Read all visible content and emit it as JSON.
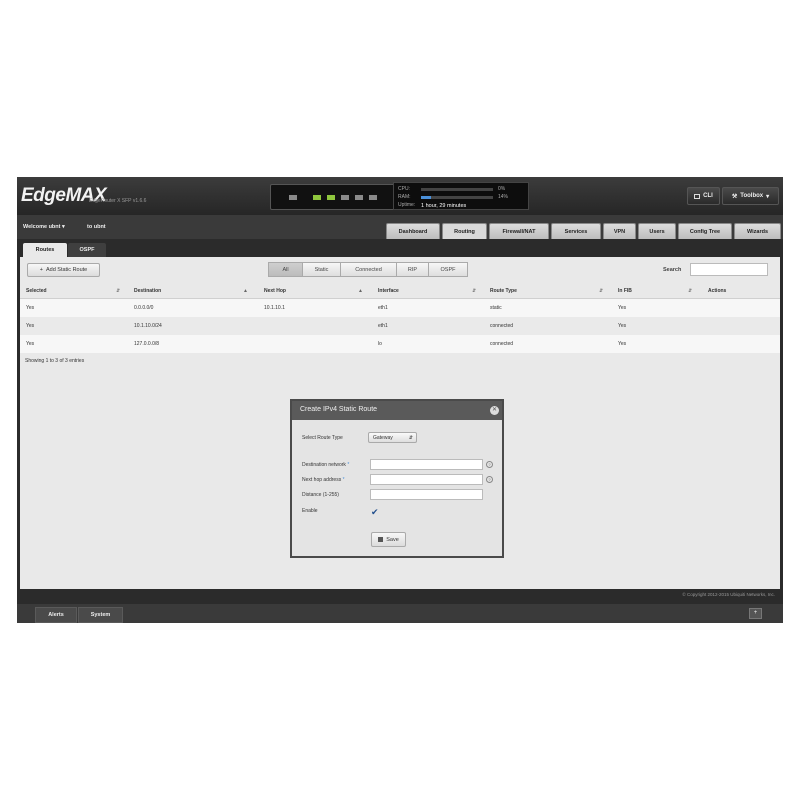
{
  "app": {
    "logo": "EdgeMAX",
    "device": "EdgeRouter X SFP v1.6.6"
  },
  "status": {
    "cpu_label": "CPU:",
    "cpu_value": "0%",
    "cpu_fraction": 0.0,
    "ram_label": "RAM:",
    "ram_value": "14%",
    "ram_fraction": 0.14,
    "uptime_label": "Uptime:",
    "uptime_value": "1 hour, 29 minutes"
  },
  "header": {
    "cli_label": "CLI",
    "toolbox_label": "Toolbox"
  },
  "user": {
    "welcome": "Welcome ubnt",
    "to": "to ubnt"
  },
  "nav": {
    "tabs": [
      "Dashboard",
      "Routing",
      "Firewall/NAT",
      "Services",
      "VPN",
      "Users",
      "Config Tree",
      "Wizards"
    ],
    "active": "Routing"
  },
  "subtabs": [
    "Routes",
    "OSPF"
  ],
  "toolbar": {
    "add_label": "Add Static Route",
    "filters": [
      "All",
      "Static",
      "Connected",
      "RIP",
      "OSPF"
    ],
    "active_filter": "All",
    "search_label": "Search"
  },
  "table": {
    "columns": [
      "Selected",
      "Destination",
      "Next Hop",
      "Interface",
      "Route Type",
      "In FIB",
      "Actions"
    ],
    "rows": [
      [
        "Yes",
        "0.0.0.0/0",
        "10.1.10.1",
        "eth1",
        "static",
        "Yes",
        ""
      ],
      [
        "Yes",
        "10.1.10.0/24",
        "",
        "eth1",
        "connected",
        "Yes",
        ""
      ],
      [
        "Yes",
        "127.0.0.0/8",
        "",
        "lo",
        "connected",
        "Yes",
        ""
      ]
    ],
    "showing": "Showing 1 to 3 of 3 entries"
  },
  "modal": {
    "title": "Create IPv4 Static Route",
    "route_type_label": "Select Route Type",
    "route_type_value": "Gateway",
    "dest_label": "Destination network",
    "nexthop_label": "Next hop address",
    "distance_label": "Distance (1-255)",
    "enable_label": "Enable",
    "required_mark": "*",
    "save_label": "Save",
    "enabled": true
  },
  "footer": {
    "copyright": "© Copyright 2012-2015 Ubiquiti Networks, Inc."
  },
  "bottom": {
    "tabs": [
      "Alerts",
      "System"
    ]
  },
  "colors": {
    "accent": "#4a90d9",
    "port_active": "#8fc63d"
  }
}
